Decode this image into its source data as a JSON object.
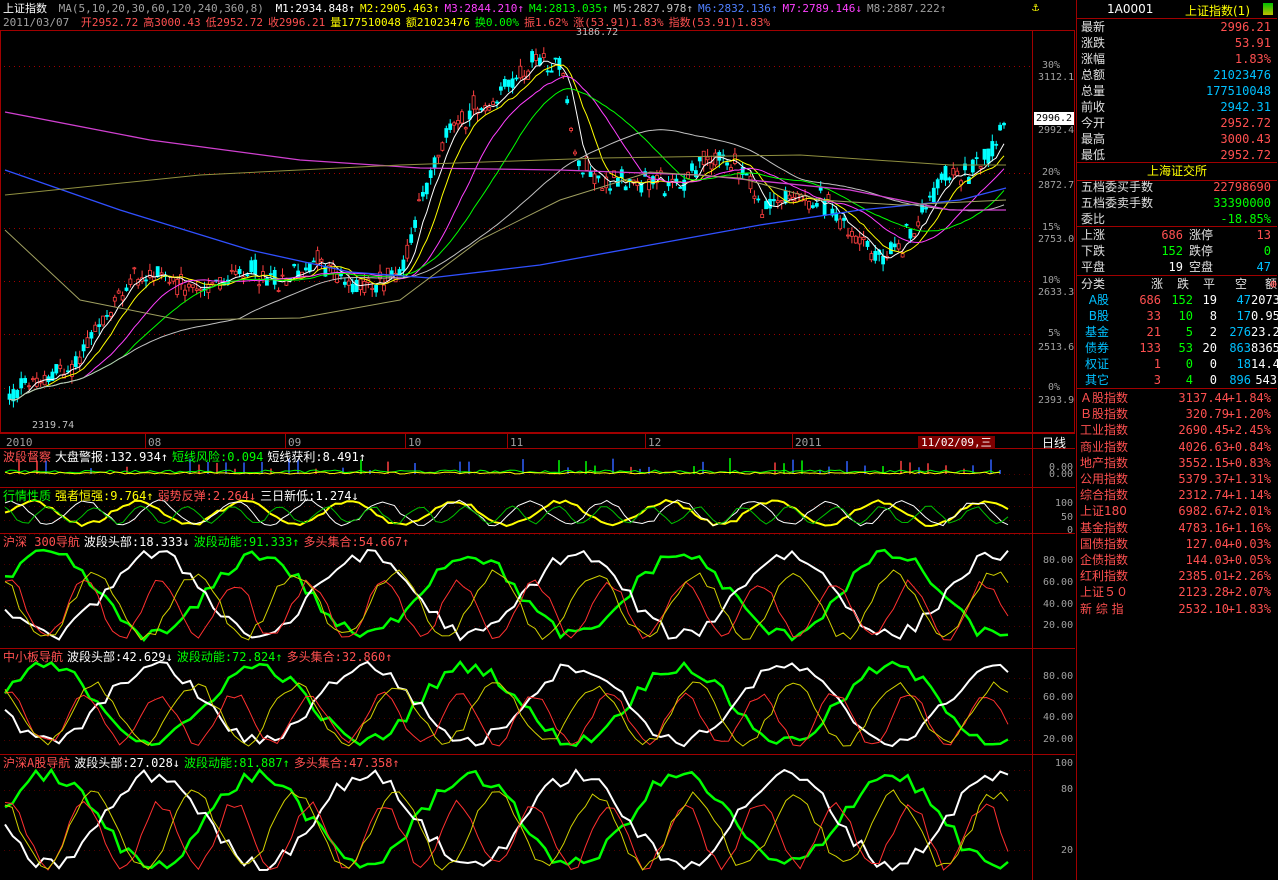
{
  "header": {
    "title": "上证指数",
    "ma_label": "MA(5,10,20,30,60,120,240,360,8)",
    "ma": [
      {
        "label": "M1:2934.848↑",
        "color": "#ffffff"
      },
      {
        "label": "M2:2905.463↑",
        "color": "#ffff00"
      },
      {
        "label": "M3:2844.210↑",
        "color": "#ff40ff"
      },
      {
        "label": "M4:2813.035↑",
        "color": "#00ff00"
      },
      {
        "label": "M5:2827.978↑",
        "color": "#c0c0c0"
      },
      {
        "label": "M6:2832.136↑",
        "color": "#5080ff"
      },
      {
        "label": "M7:2789.146↓",
        "color": "#ff40ff"
      },
      {
        "label": "M8:2887.222↑",
        "color": "#a0a0a0"
      }
    ],
    "info_date": "2011/03/07",
    "info_items": [
      {
        "label": "开2952.72",
        "color": "#ff5050"
      },
      {
        "label": "高3000.43",
        "color": "#ff5050"
      },
      {
        "label": "低2952.72",
        "color": "#ff5050"
      },
      {
        "label": "收2996.21",
        "color": "#ff5050"
      },
      {
        "label": "量177510048",
        "color": "#ffff00"
      },
      {
        "label": "额21023476",
        "color": "#ffff00"
      },
      {
        "label": "换0.00%",
        "color": "#00ff00"
      },
      {
        "label": "振1.62%",
        "color": "#ff5050"
      },
      {
        "label": "涨(53.91)1.83%",
        "color": "#ff5050"
      },
      {
        "label": "指数(53.91)1.83%",
        "color": "#ff5050"
      }
    ]
  },
  "main_chart": {
    "high_label": "3186.72",
    "low_label": "2319.74",
    "current_price_tag": "2996.2",
    "price_axis": [
      "3112.1",
      "2992.4",
      "2872.7",
      "2753.0",
      "2633.3",
      "2513.6",
      "2393.9"
    ],
    "pct_axis": [
      "30%",
      "20%",
      "15%",
      "10%",
      "5%",
      "0%"
    ],
    "date_axis": [
      "2010",
      "08",
      "09",
      "10",
      "11",
      "12",
      "2011"
    ],
    "date_highlight": "11/02/09,三",
    "period_label": "日线"
  },
  "indicators": {
    "ind1": {
      "items": [
        {
          "label": "波段督察",
          "color": "#ff5050"
        },
        {
          "label": "大盘警报:132.934↑",
          "color": "#ffffff"
        },
        {
          "label": "短线风险:0.094",
          "color": "#00ff00"
        },
        {
          "label": "短线获利:8.491↑",
          "color": "#ffffff"
        }
      ],
      "axis": [
        "0.00",
        "0.00"
      ]
    },
    "ind2": {
      "items": [
        {
          "label": "行情性质",
          "color": "#00ff00"
        },
        {
          "label": "强者恒强:9.764↑",
          "color": "#ffff00"
        },
        {
          "label": "弱势反弹:2.264↓",
          "color": "#ff5050"
        },
        {
          "label": "三日新低:1.274↓",
          "color": "#ffffff"
        }
      ],
      "axis": [
        "100",
        "50",
        "0"
      ]
    },
    "ind3": {
      "items": [
        {
          "label": "沪深 300导航",
          "color": "#ff5050"
        },
        {
          "label": "波段头部:18.333↓",
          "color": "#ffffff"
        },
        {
          "label": "波段动能:91.333↑",
          "color": "#00ff00"
        },
        {
          "label": "多头集合:54.667↑",
          "color": "#ff5050"
        }
      ],
      "axis": [
        "80.00",
        "60.00",
        "40.00",
        "20.00"
      ]
    },
    "ind4": {
      "items": [
        {
          "label": "中小板导航",
          "color": "#ff5050"
        },
        {
          "label": "波段头部:42.629↓",
          "color": "#ffffff"
        },
        {
          "label": "波段动能:72.824↑",
          "color": "#00ff00"
        },
        {
          "label": "多头集合:32.860↑",
          "color": "#ff5050"
        }
      ],
      "axis": [
        "80.00",
        "60.00",
        "40.00",
        "20.00"
      ]
    },
    "ind5": {
      "items": [
        {
          "label": "沪深A股导航",
          "color": "#ff5050"
        },
        {
          "label": "波段头部:27.028↓",
          "color": "#ffffff"
        },
        {
          "label": "波段动能:81.887↑",
          "color": "#00ff00"
        },
        {
          "label": "多头集合:47.358↑",
          "color": "#ff5050"
        }
      ],
      "axis": [
        "100",
        "80",
        "20"
      ]
    }
  },
  "right_panel": {
    "code": "1A0001",
    "name": "上证指数(1)",
    "quote": [
      {
        "label": "最新",
        "value": "2996.21",
        "color": "#ff5050"
      },
      {
        "label": "涨跌",
        "value": "53.91",
        "color": "#ff5050"
      },
      {
        "label": "涨幅",
        "value": "1.83%",
        "color": "#ff5050"
      },
      {
        "label": "总额",
        "value": "21023476",
        "color": "#00c0ff"
      },
      {
        "label": "总量",
        "value": "177510048",
        "color": "#00c0ff"
      },
      {
        "label": "前收",
        "value": "2942.31",
        "color": "#00c0ff"
      },
      {
        "label": "今开",
        "value": "2952.72",
        "color": "#ff5050"
      },
      {
        "label": "最高",
        "value": "3000.43",
        "color": "#ff5050"
      },
      {
        "label": "最低",
        "value": "2952.72",
        "color": "#ff5050"
      }
    ],
    "exchange": "上海证交所",
    "depth": [
      {
        "label": "五档委买手数",
        "value": "22798690",
        "color": "#ff5050"
      },
      {
        "label": "五档委卖手数",
        "value": "33390000",
        "color": "#00ff00"
      },
      {
        "label": "委比",
        "value": "-18.85%",
        "color": "#00ff00"
      }
    ],
    "breadth": [
      {
        "l1": "上涨",
        "v1": "686",
        "c1": "#ff5050",
        "l2": "涨停",
        "v2": "13",
        "c2": "#ff5050"
      },
      {
        "l1": "下跌",
        "v1": "152",
        "c1": "#00ff00",
        "l2": "跌停",
        "v2": "0",
        "c2": "#00ff00"
      },
      {
        "l1": "平盘",
        "v1": "19",
        "c1": "#ffffff",
        "l2": "空盘",
        "v2": "47",
        "c2": "#00c0ff"
      }
    ],
    "class_header": [
      "分类",
      "涨",
      "跌",
      "平",
      "空",
      "额"
    ],
    "class_rows": [
      [
        "A股",
        "686",
        "152",
        "19",
        "47",
        "2073"
      ],
      [
        "B股",
        "33",
        "10",
        "8",
        "17",
        "0.95"
      ],
      [
        "基金",
        "21",
        "5",
        "2",
        "276",
        "23.2"
      ],
      [
        "债券",
        "133",
        "53",
        "20",
        "863",
        "8365"
      ],
      [
        "权证",
        "1",
        "0",
        "0",
        "18",
        "14.4"
      ],
      [
        "其它",
        "3",
        "4",
        "0",
        "896",
        "543"
      ]
    ],
    "indices": [
      {
        "name": "Ａ股指数",
        "value": "3137.44",
        "pct": "+1.84%"
      },
      {
        "name": "Ｂ股指数",
        "value": "320.79",
        "pct": "+1.20%"
      },
      {
        "name": "工业指数",
        "value": "2690.45",
        "pct": "+2.45%"
      },
      {
        "name": "商业指数",
        "value": "4026.63",
        "pct": "+0.84%"
      },
      {
        "name": "地产指数",
        "value": "3552.15",
        "pct": "+0.83%"
      },
      {
        "name": "公用指数",
        "value": "5379.37",
        "pct": "+1.31%"
      },
      {
        "name": "综合指数",
        "value": "2312.74",
        "pct": "+1.14%"
      },
      {
        "name": "上证180",
        "value": "6982.67",
        "pct": "+2.01%"
      },
      {
        "name": "基金指数",
        "value": "4783.16",
        "pct": "+1.16%"
      },
      {
        "name": "国债指数",
        "value": "127.04",
        "pct": "+0.03%"
      },
      {
        "name": "企债指数",
        "value": "144.03",
        "pct": "+0.05%"
      },
      {
        "name": "红利指数",
        "value": "2385.01",
        "pct": "+2.26%"
      },
      {
        "name": "上证５０",
        "value": "2123.28",
        "pct": "+2.07%"
      },
      {
        "name": "新 综 指",
        "value": "2532.10",
        "pct": "+1.83%"
      }
    ]
  }
}
